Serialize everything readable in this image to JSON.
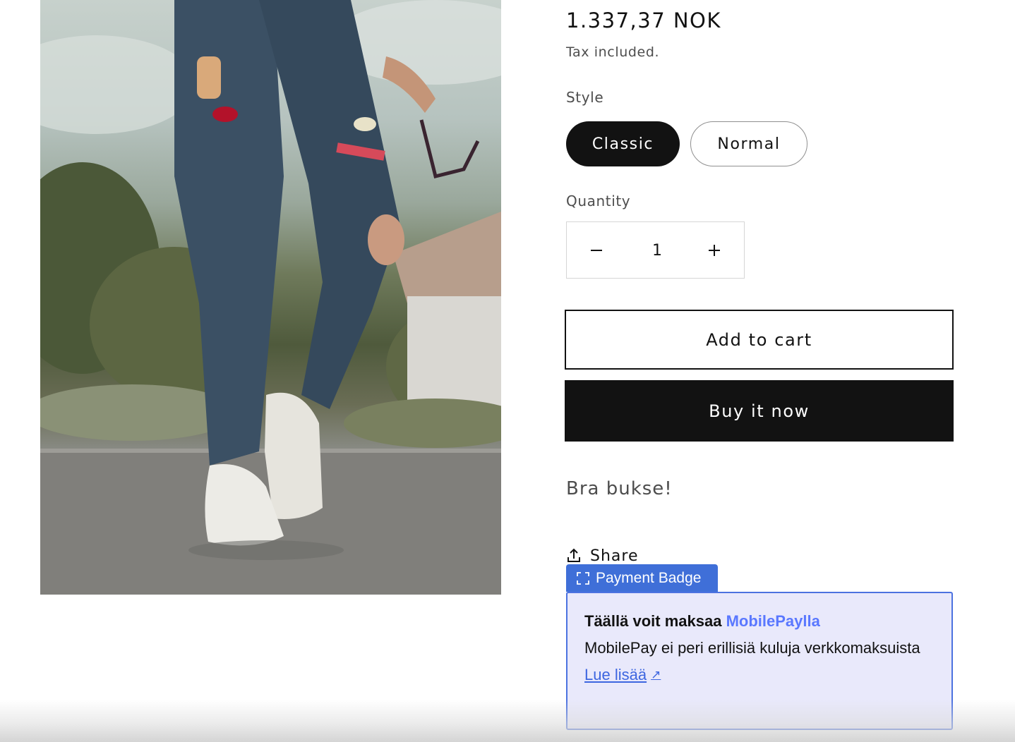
{
  "product": {
    "image_alt": "Person wearing ripped patched jeans and white sneakers holding glasses",
    "price": "1.337,37 NOK",
    "tax_note": "Tax included.",
    "style_label": "Style",
    "style_options": [
      {
        "label": "Classic",
        "selected": true
      },
      {
        "label": "Normal",
        "selected": false
      }
    ],
    "quantity_label": "Quantity",
    "quantity_value": "1",
    "add_to_cart": "Add to cart",
    "buy_now": "Buy it now",
    "description": "Bra bukse!",
    "share_label": "Share"
  },
  "payment_badge": {
    "tab_label": "Payment Badge",
    "headline": "Täällä voit maksaa",
    "brand": "MobilePaylla",
    "text": "MobilePay ei peri erillisiä kuluja verkkomaksuista",
    "link_label": "Lue lisää",
    "link_arrow": "↗"
  },
  "icons": {
    "minus": "minus-icon",
    "plus": "plus-icon",
    "share": "share-icon",
    "badge": "frame-icon"
  },
  "colors": {
    "primary": "#121212",
    "muted_text": "#4d4d4d",
    "badge_accent": "#3f6fd8",
    "badge_bg": "#e9e9fb",
    "brand": "#5a78ff"
  }
}
